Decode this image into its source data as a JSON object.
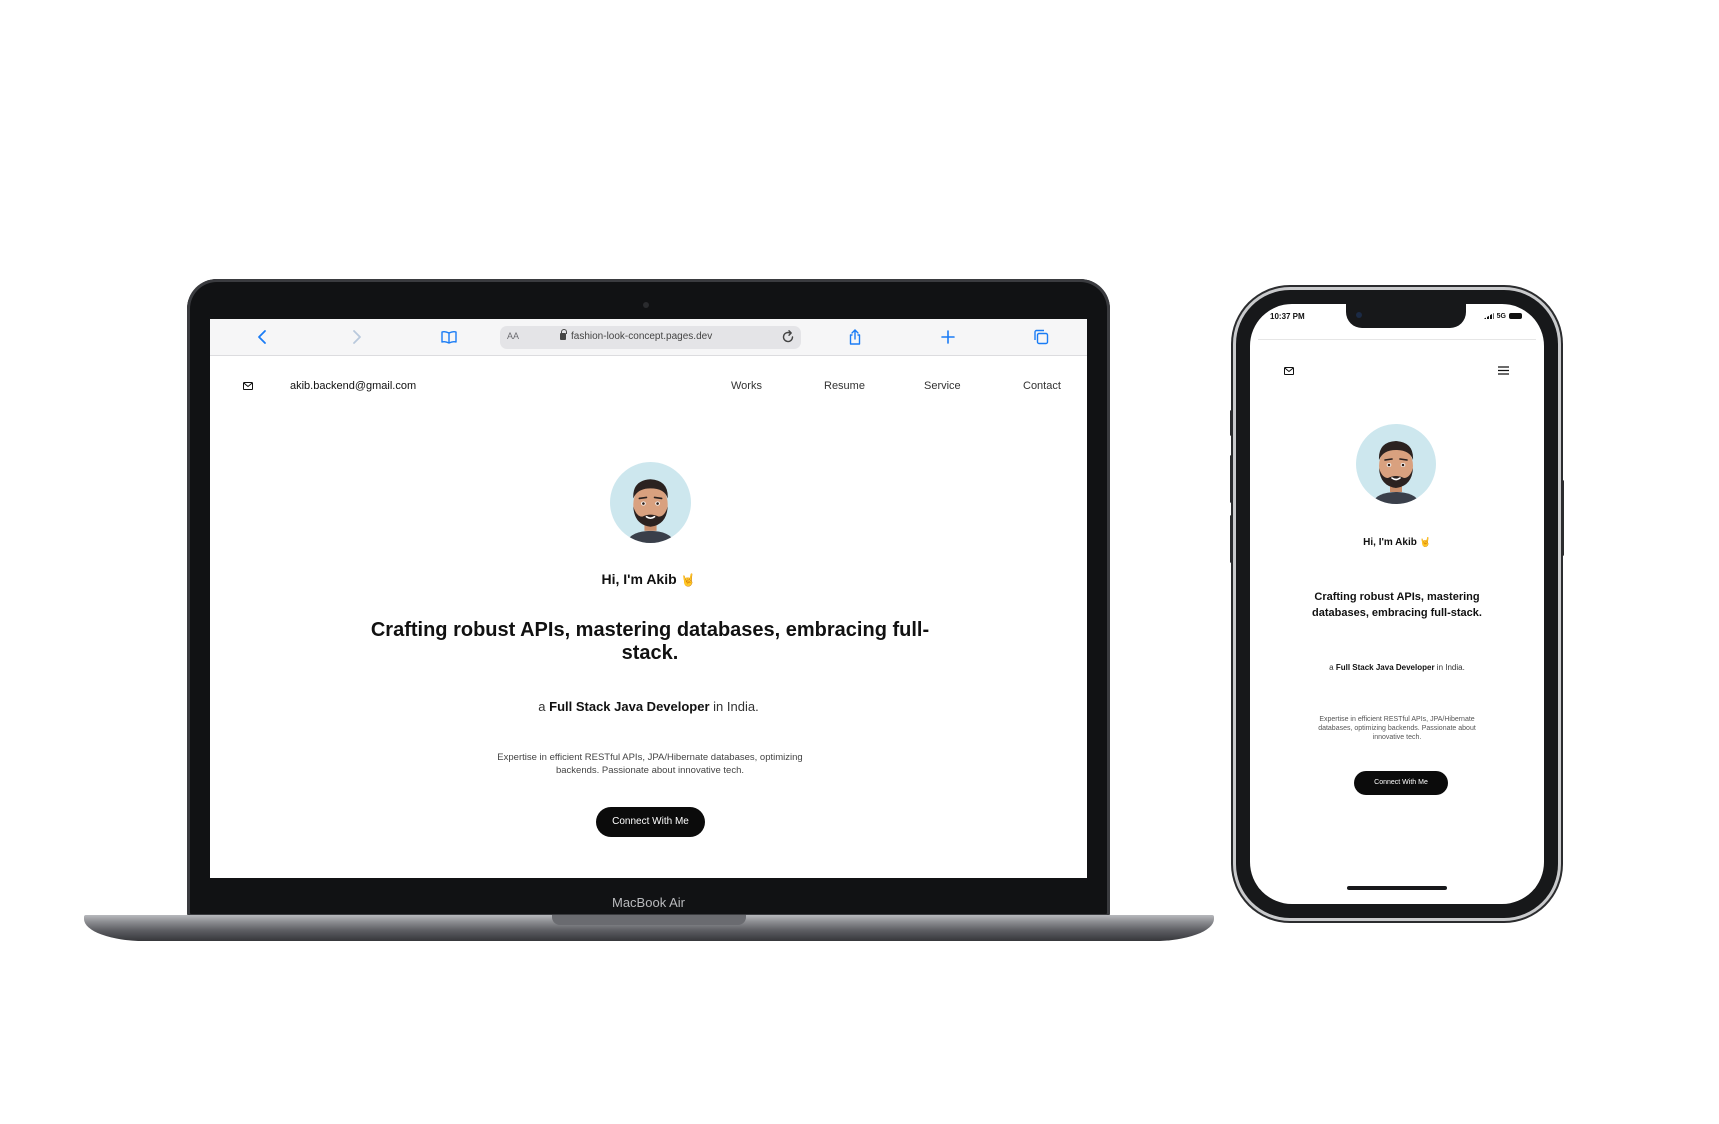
{
  "laptop": {
    "brand_label": "MacBook Air",
    "browser": {
      "text_size_label": "AA",
      "url": "fashion-look-concept.pages.dev"
    }
  },
  "site": {
    "email": "akib.backend@gmail.com",
    "nav": [
      "Works",
      "Resume",
      "Service",
      "Contact"
    ],
    "greeting": "Hi, I'm Akib",
    "greeting_emoji": "🤘",
    "headline": "Crafting robust APIs, mastering databases, embracing full-stack.",
    "role_prefix": "a",
    "role_title": "Full Stack Java Developer",
    "role_suffix": "in India.",
    "blurb": "Expertise in efficient RESTful APIs, JPA/Hibernate databases, optimizing backends. Passionate about innovative tech.",
    "cta_label": "Connect With Me"
  },
  "phone": {
    "status_time": "10:37 PM",
    "status_network": "5G"
  },
  "icons": {
    "browser": [
      "back-icon",
      "forward-icon",
      "book-icon",
      "lock-icon",
      "reload-icon",
      "share-icon",
      "plus-icon",
      "tabs-icon"
    ],
    "site": [
      "mail-icon",
      "hamburger-menu-icon"
    ]
  },
  "colors": {
    "safari_accent": "#1a7cf5",
    "avatar_bg": "#cde7ee",
    "button_bg": "#0b0b0b",
    "wave_emoji": "#f3b31d"
  }
}
